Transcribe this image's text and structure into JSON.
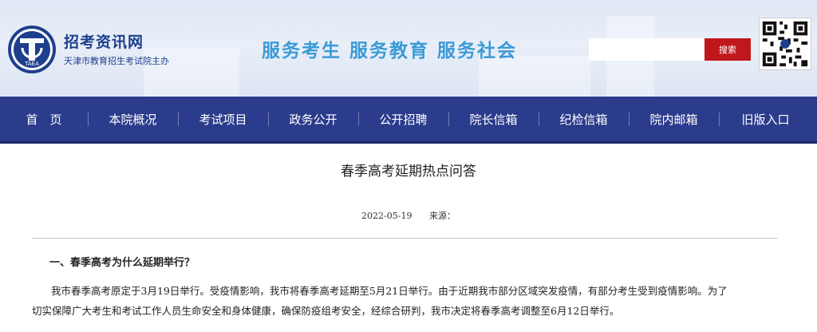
{
  "header": {
    "brand_name": "招考资讯网",
    "brand_sub": "天津市教育招生考试院主办",
    "logo_text": "TAEA",
    "slogan": "服务考生 服务教育 服务社会",
    "search": {
      "placeholder": "",
      "button_label": "搜索"
    }
  },
  "nav": {
    "items": [
      {
        "label": "首　页"
      },
      {
        "label": "本院概况"
      },
      {
        "label": "考试项目"
      },
      {
        "label": "政务公开"
      },
      {
        "label": "公开招聘"
      },
      {
        "label": "院长信箱"
      },
      {
        "label": "纪检信箱"
      },
      {
        "label": "院内邮箱"
      },
      {
        "label": "旧版入口"
      }
    ]
  },
  "article": {
    "title": "春季高考延期热点问答",
    "date": "2022-05-19",
    "source_label": "来源："
  },
  "content": {
    "q1": "一、春季高考为什么延期举行？",
    "a1_line1": "我市春季高考原定于3月19日举行。受疫情影响，我市将春季高考延期至5月21日举行。由于近期我市部分区域突发疫情，有部分考生受到疫情影响。为了",
    "a1_line2": "切实保障广大考生和考试工作人员生命安全和身体健康，确保防疫组考安全，经综合研判，我市决定将春季高考调整至6月12日举行。"
  },
  "colors": {
    "nav_bg": "#2b3c8c",
    "brand": "#1d3f8d",
    "slogan": "#3a9ad6",
    "search_button": "#c0171d"
  }
}
